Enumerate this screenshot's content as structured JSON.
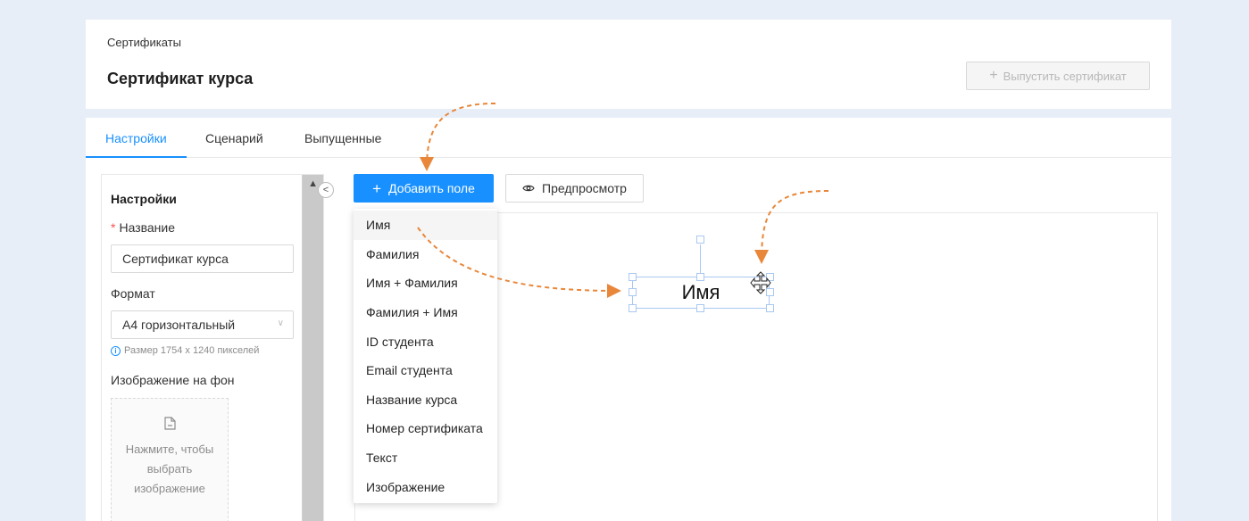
{
  "header": {
    "breadcrumb": "Сертификаты",
    "title": "Сертификат курса",
    "issue_button": "Выпустить сертификат"
  },
  "tabs": [
    {
      "label": "Настройки",
      "active": true
    },
    {
      "label": "Сценарий",
      "active": false
    },
    {
      "label": "Выпущенные",
      "active": false
    }
  ],
  "settings": {
    "title": "Настройки",
    "name_label": "Название",
    "name_value": "Сертификат курса",
    "format_label": "Формат",
    "format_value": "A4 горизонтальный",
    "size_hint": "Размер 1754 x 1240 пикселей",
    "bg_label": "Изображение на фон",
    "upload_text": "Нажмите, чтобы выбрать изображение"
  },
  "toolbar": {
    "add_field": "Добавить поле",
    "preview": "Предпросмотр"
  },
  "dropdown": {
    "items": [
      "Имя",
      "Фамилия",
      "Имя + Фамилия",
      "Фамилия + Имя",
      "ID студента",
      "Email студента",
      "Название курса",
      "Номер сертификата",
      "Текст",
      "Изображение"
    ],
    "hovered": "Имя"
  },
  "canvas": {
    "field_text": "Имя"
  },
  "colors": {
    "primary": "#1890ff",
    "annotation": "#e8873a",
    "selection": "#a9c8f0"
  }
}
